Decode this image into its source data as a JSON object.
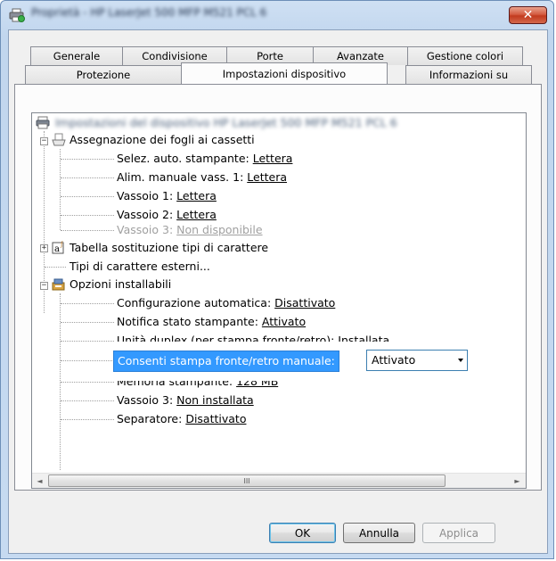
{
  "window": {
    "title": "Proprietà - HP LaserJet 500 MFP M521 PCL 6",
    "close_label": "✕"
  },
  "tabs_row1": [
    "Generale",
    "Condivisione",
    "Porte",
    "Avanzate",
    "Gestione colori"
  ],
  "tabs_row2": [
    "Protezione",
    "Impostazioni dispositivo",
    "Informazioni su"
  ],
  "active_tab": "Impostazioni dispositivo",
  "tree": {
    "root": "Impostazioni del dispositivo HP LaserJet 500 MFP M521 PCL 6",
    "tray_assignment": {
      "label": "Assegnazione dei fogli ai cassetti",
      "items": [
        {
          "name": "Selez. auto. stampante: ",
          "value": "Lettera"
        },
        {
          "name": "Alim. manuale vass. 1: ",
          "value": "Lettera"
        },
        {
          "name": "Vassoio 1: ",
          "value": "Lettera"
        },
        {
          "name": "Vassoio 2: ",
          "value": "Lettera"
        },
        {
          "name": "Vassoio 3: ",
          "value": "Non disponibile"
        }
      ]
    },
    "font_substitution": "Tabella sostituzione tipi di carattere",
    "external_fonts": "Tipi di carattere esterni...",
    "installable_options": {
      "label": "Opzioni installabili",
      "items": [
        {
          "name": "Configurazione automatica: ",
          "value": "Disattivato"
        },
        {
          "name": "Notifica stato stampante: ",
          "value": "Attivato"
        },
        {
          "name": "Unità duplex (per stampa fronte/retro): ",
          "value": "Installata"
        },
        {
          "name": "Memoria stampante: ",
          "value": "128 MB"
        },
        {
          "name": "Vassoio 3: ",
          "value": "Non installata"
        },
        {
          "name": "Separatore: ",
          "value": "Disattivato"
        }
      ]
    },
    "editing": {
      "label": "Consenti stampa fronte/retro manuale:",
      "value": "Attivato"
    }
  },
  "scrollbar": {
    "thumb_grip": "III",
    "left": "◄",
    "right": "►"
  },
  "buttons": {
    "ok": "OK",
    "cancel": "Annulla",
    "apply": "Applica"
  }
}
